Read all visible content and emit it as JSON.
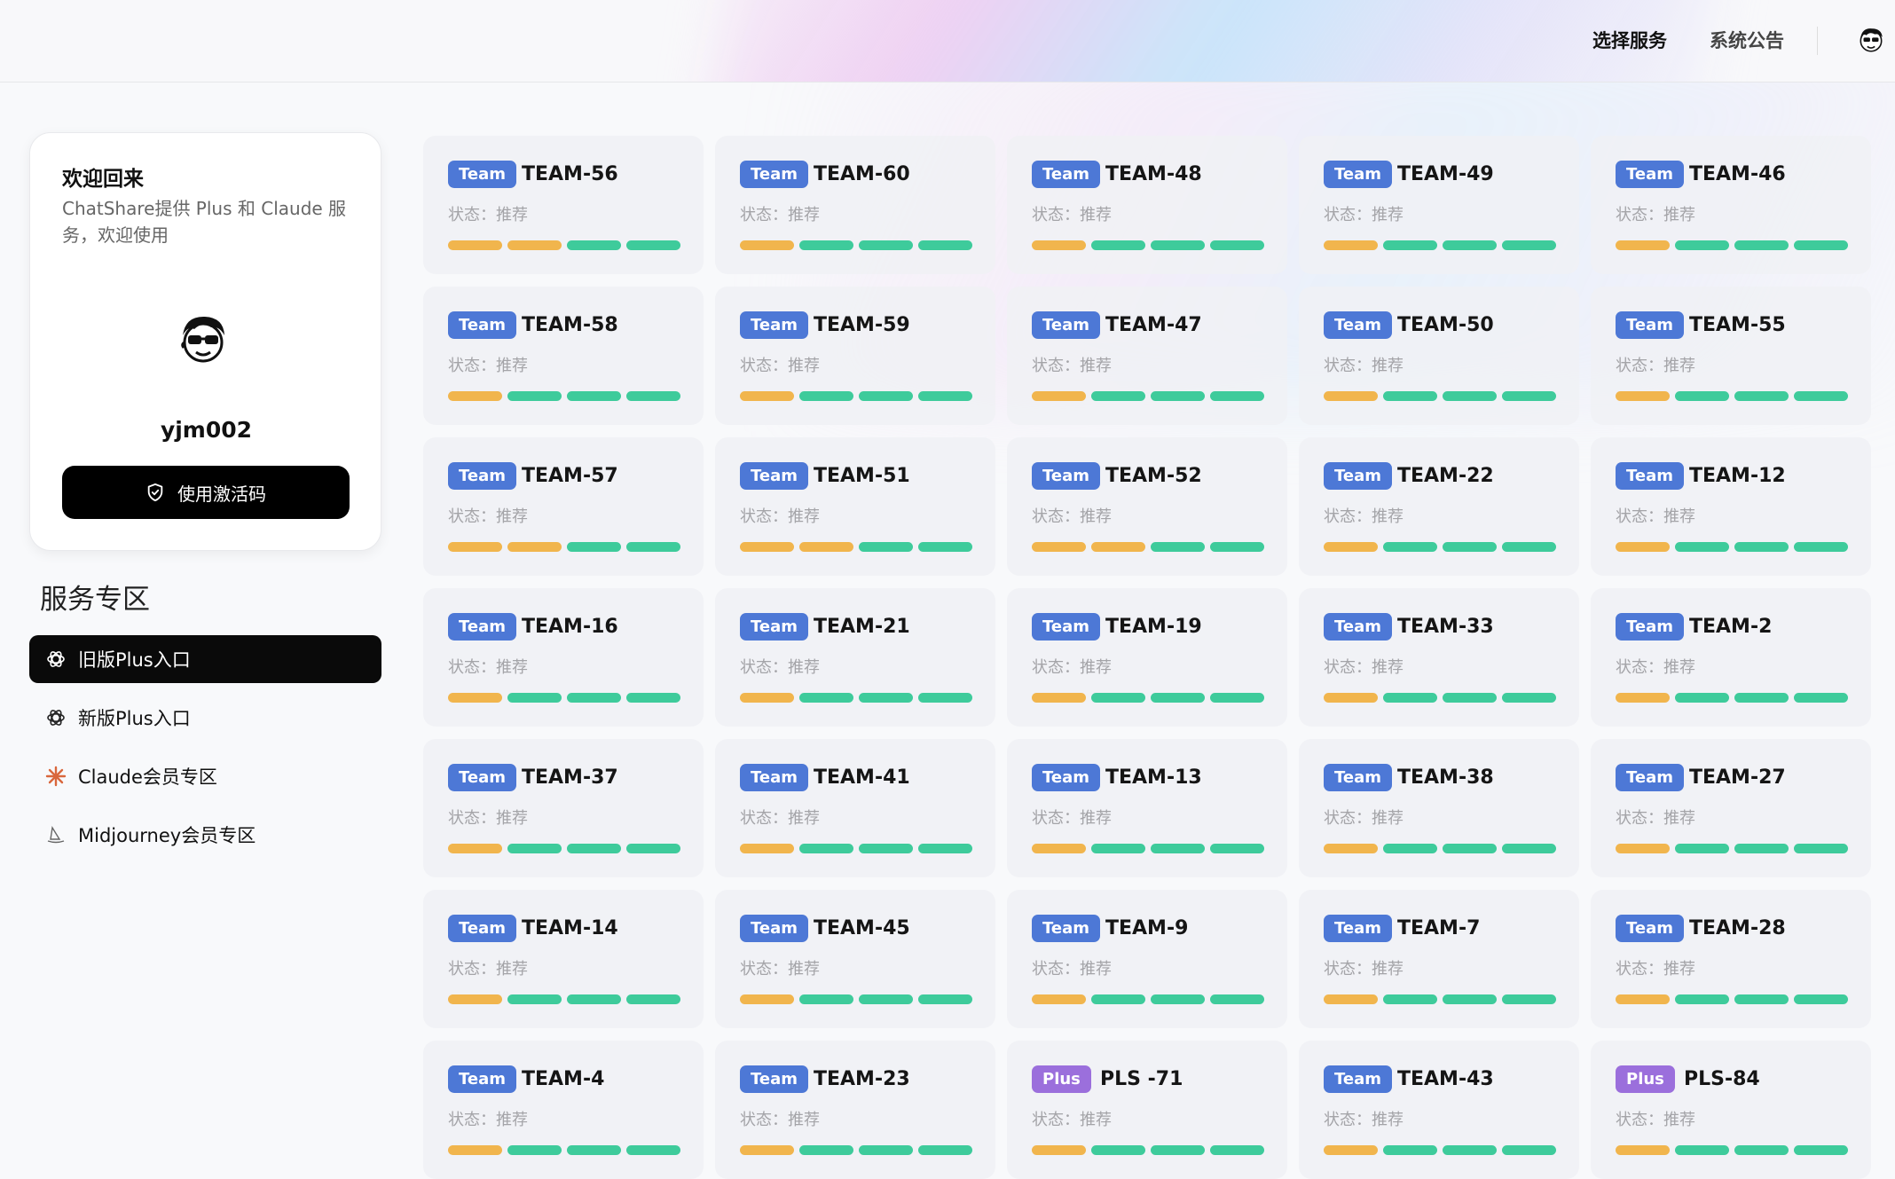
{
  "header": {
    "nav": [
      {
        "label": "选择服务",
        "active": true
      },
      {
        "label": "系统公告",
        "active": false
      }
    ],
    "avatar_icon": "cartoon-avatar-icon"
  },
  "welcome": {
    "title": "欢迎回来",
    "description": "ChatShare提供 Plus 和 Claude 服务，欢迎使用",
    "username": "yjm002",
    "activate_button": "使用激活码",
    "activate_icon": "shield-check-icon"
  },
  "sidebar": {
    "section_title": "服务专区",
    "items": [
      {
        "label": "旧版Plus入口",
        "icon": "openai-icon",
        "active": true
      },
      {
        "label": "新版Plus入口",
        "icon": "openai-icon",
        "active": false
      },
      {
        "label": "Claude会员专区",
        "icon": "claude-sparkle-icon",
        "active": false
      },
      {
        "label": "Midjourney会员专区",
        "icon": "midjourney-sail-icon",
        "active": false
      }
    ]
  },
  "colors": {
    "team_badge": "#4d78d6",
    "plus_badge": "#9b6fdc",
    "bar_orange": "#f1b54d",
    "bar_green": "#3ecb9b"
  },
  "cards": [
    {
      "badge": "Team",
      "name": "TEAM-56",
      "status": "状态：推荐",
      "bars": [
        "o",
        "o",
        "g",
        "g"
      ]
    },
    {
      "badge": "Team",
      "name": "TEAM-60",
      "status": "状态：推荐",
      "bars": [
        "o",
        "g",
        "g",
        "g"
      ]
    },
    {
      "badge": "Team",
      "name": "TEAM-48",
      "status": "状态：推荐",
      "bars": [
        "o",
        "g",
        "g",
        "g"
      ]
    },
    {
      "badge": "Team",
      "name": "TEAM-49",
      "status": "状态：推荐",
      "bars": [
        "o",
        "g",
        "g",
        "g"
      ]
    },
    {
      "badge": "Team",
      "name": "TEAM-46",
      "status": "状态：推荐",
      "bars": [
        "o",
        "g",
        "g",
        "g"
      ]
    },
    {
      "badge": "Team",
      "name": "TEAM-58",
      "status": "状态：推荐",
      "bars": [
        "o",
        "g",
        "g",
        "g"
      ]
    },
    {
      "badge": "Team",
      "name": "TEAM-59",
      "status": "状态：推荐",
      "bars": [
        "o",
        "g",
        "g",
        "g"
      ]
    },
    {
      "badge": "Team",
      "name": "TEAM-47",
      "status": "状态：推荐",
      "bars": [
        "o",
        "g",
        "g",
        "g"
      ]
    },
    {
      "badge": "Team",
      "name": "TEAM-50",
      "status": "状态：推荐",
      "bars": [
        "o",
        "g",
        "g",
        "g"
      ]
    },
    {
      "badge": "Team",
      "name": "TEAM-55",
      "status": "状态：推荐",
      "bars": [
        "o",
        "g",
        "g",
        "g"
      ]
    },
    {
      "badge": "Team",
      "name": "TEAM-57",
      "status": "状态：推荐",
      "bars": [
        "o",
        "o",
        "g",
        "g"
      ]
    },
    {
      "badge": "Team",
      "name": "TEAM-51",
      "status": "状态：推荐",
      "bars": [
        "o",
        "o",
        "g",
        "g"
      ]
    },
    {
      "badge": "Team",
      "name": "TEAM-52",
      "status": "状态：推荐",
      "bars": [
        "o",
        "o",
        "g",
        "g"
      ]
    },
    {
      "badge": "Team",
      "name": "TEAM-22",
      "status": "状态：推荐",
      "bars": [
        "o",
        "g",
        "g",
        "g"
      ]
    },
    {
      "badge": "Team",
      "name": "TEAM-12",
      "status": "状态：推荐",
      "bars": [
        "o",
        "g",
        "g",
        "g"
      ]
    },
    {
      "badge": "Team",
      "name": "TEAM-16",
      "status": "状态：推荐",
      "bars": [
        "o",
        "g",
        "g",
        "g"
      ]
    },
    {
      "badge": "Team",
      "name": "TEAM-21",
      "status": "状态：推荐",
      "bars": [
        "o",
        "g",
        "g",
        "g"
      ]
    },
    {
      "badge": "Team",
      "name": "TEAM-19",
      "status": "状态：推荐",
      "bars": [
        "o",
        "g",
        "g",
        "g"
      ]
    },
    {
      "badge": "Team",
      "name": "TEAM-33",
      "status": "状态：推荐",
      "bars": [
        "o",
        "g",
        "g",
        "g"
      ]
    },
    {
      "badge": "Team",
      "name": "TEAM-2",
      "status": "状态：推荐",
      "bars": [
        "o",
        "g",
        "g",
        "g"
      ]
    },
    {
      "badge": "Team",
      "name": "TEAM-37",
      "status": "状态：推荐",
      "bars": [
        "o",
        "g",
        "g",
        "g"
      ]
    },
    {
      "badge": "Team",
      "name": "TEAM-41",
      "status": "状态：推荐",
      "bars": [
        "o",
        "g",
        "g",
        "g"
      ]
    },
    {
      "badge": "Team",
      "name": "TEAM-13",
      "status": "状态：推荐",
      "bars": [
        "o",
        "g",
        "g",
        "g"
      ]
    },
    {
      "badge": "Team",
      "name": "TEAM-38",
      "status": "状态：推荐",
      "bars": [
        "o",
        "g",
        "g",
        "g"
      ]
    },
    {
      "badge": "Team",
      "name": "TEAM-27",
      "status": "状态：推荐",
      "bars": [
        "o",
        "g",
        "g",
        "g"
      ]
    },
    {
      "badge": "Team",
      "name": "TEAM-14",
      "status": "状态：推荐",
      "bars": [
        "o",
        "g",
        "g",
        "g"
      ]
    },
    {
      "badge": "Team",
      "name": "TEAM-45",
      "status": "状态：推荐",
      "bars": [
        "o",
        "g",
        "g",
        "g"
      ]
    },
    {
      "badge": "Team",
      "name": "TEAM-9",
      "status": "状态：推荐",
      "bars": [
        "o",
        "g",
        "g",
        "g"
      ]
    },
    {
      "badge": "Team",
      "name": "TEAM-7",
      "status": "状态：推荐",
      "bars": [
        "o",
        "g",
        "g",
        "g"
      ]
    },
    {
      "badge": "Team",
      "name": "TEAM-28",
      "status": "状态：推荐",
      "bars": [
        "o",
        "g",
        "g",
        "g"
      ]
    },
    {
      "badge": "Team",
      "name": "TEAM-4",
      "status": "状态：推荐",
      "bars": [
        "o",
        "g",
        "g",
        "g"
      ]
    },
    {
      "badge": "Team",
      "name": "TEAM-23",
      "status": "状态：推荐",
      "bars": [
        "o",
        "g",
        "g",
        "g"
      ]
    },
    {
      "badge": "Plus",
      "name": "PLS -71",
      "status": "状态：推荐",
      "bars": [
        "o",
        "g",
        "g",
        "g"
      ]
    },
    {
      "badge": "Team",
      "name": "TEAM-43",
      "status": "状态：推荐",
      "bars": [
        "o",
        "g",
        "g",
        "g"
      ]
    },
    {
      "badge": "Plus",
      "name": "PLS-84",
      "status": "状态：推荐",
      "bars": [
        "o",
        "g",
        "g",
        "g"
      ]
    }
  ]
}
